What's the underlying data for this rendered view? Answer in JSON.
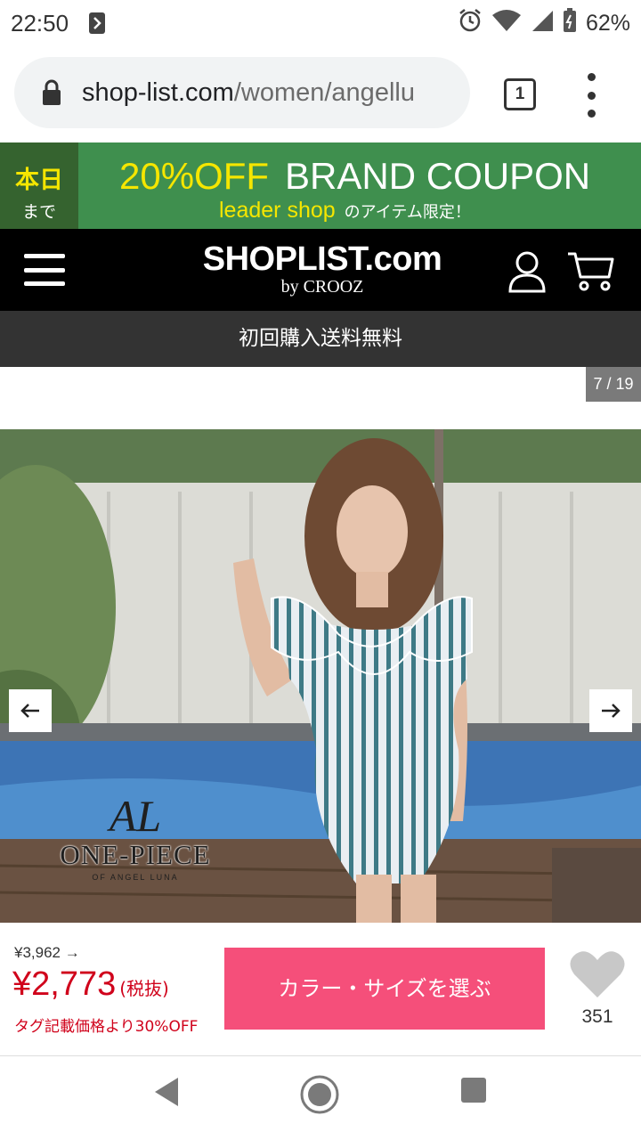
{
  "status_bar": {
    "time": "22:50",
    "battery": "62%"
  },
  "browser": {
    "url_domain": "shop-list.com",
    "url_path": "/women/angellu",
    "tab_count": "1"
  },
  "coupon_banner": {
    "today_label": "本日",
    "until_label": "まで",
    "discount": "20%OFF",
    "headline": "BRAND COUPON",
    "shop_name": "leader shop",
    "note": "のアイテム限定！"
  },
  "header": {
    "logo_main": "SHOPLIST.com",
    "logo_by": "by CROOZ"
  },
  "shipping_bar": {
    "text": "初回購入送料無料"
  },
  "gallery": {
    "counter": "7 / 19",
    "brand_monogram": "AL",
    "brand_name": "ONE-PIECE",
    "brand_sub": "OF ANGEL LUNA"
  },
  "product": {
    "original_price": "¥3,962 →",
    "sale_price": "¥2,773",
    "tax_note": "(税抜)",
    "discount_note": "タグ記載価格より30%OFF",
    "select_button": "カラー・サイズを選ぶ",
    "favorite_count": "351"
  },
  "colors": {
    "coupon_green": "#3f8f4e",
    "coupon_dark": "#35632f",
    "accent_yellow": "#f5e600",
    "header_black": "#000000",
    "price_red": "#d0021b",
    "button_pink": "#f54f7a"
  },
  "icons": [
    "wifi-icon",
    "signal-icon",
    "battery-icon",
    "alarm-icon",
    "lock-icon",
    "menu-icon",
    "user-icon",
    "cart-icon",
    "arrow-left-icon",
    "arrow-right-icon",
    "heart-icon",
    "back-icon",
    "home-icon",
    "recents-icon"
  ]
}
